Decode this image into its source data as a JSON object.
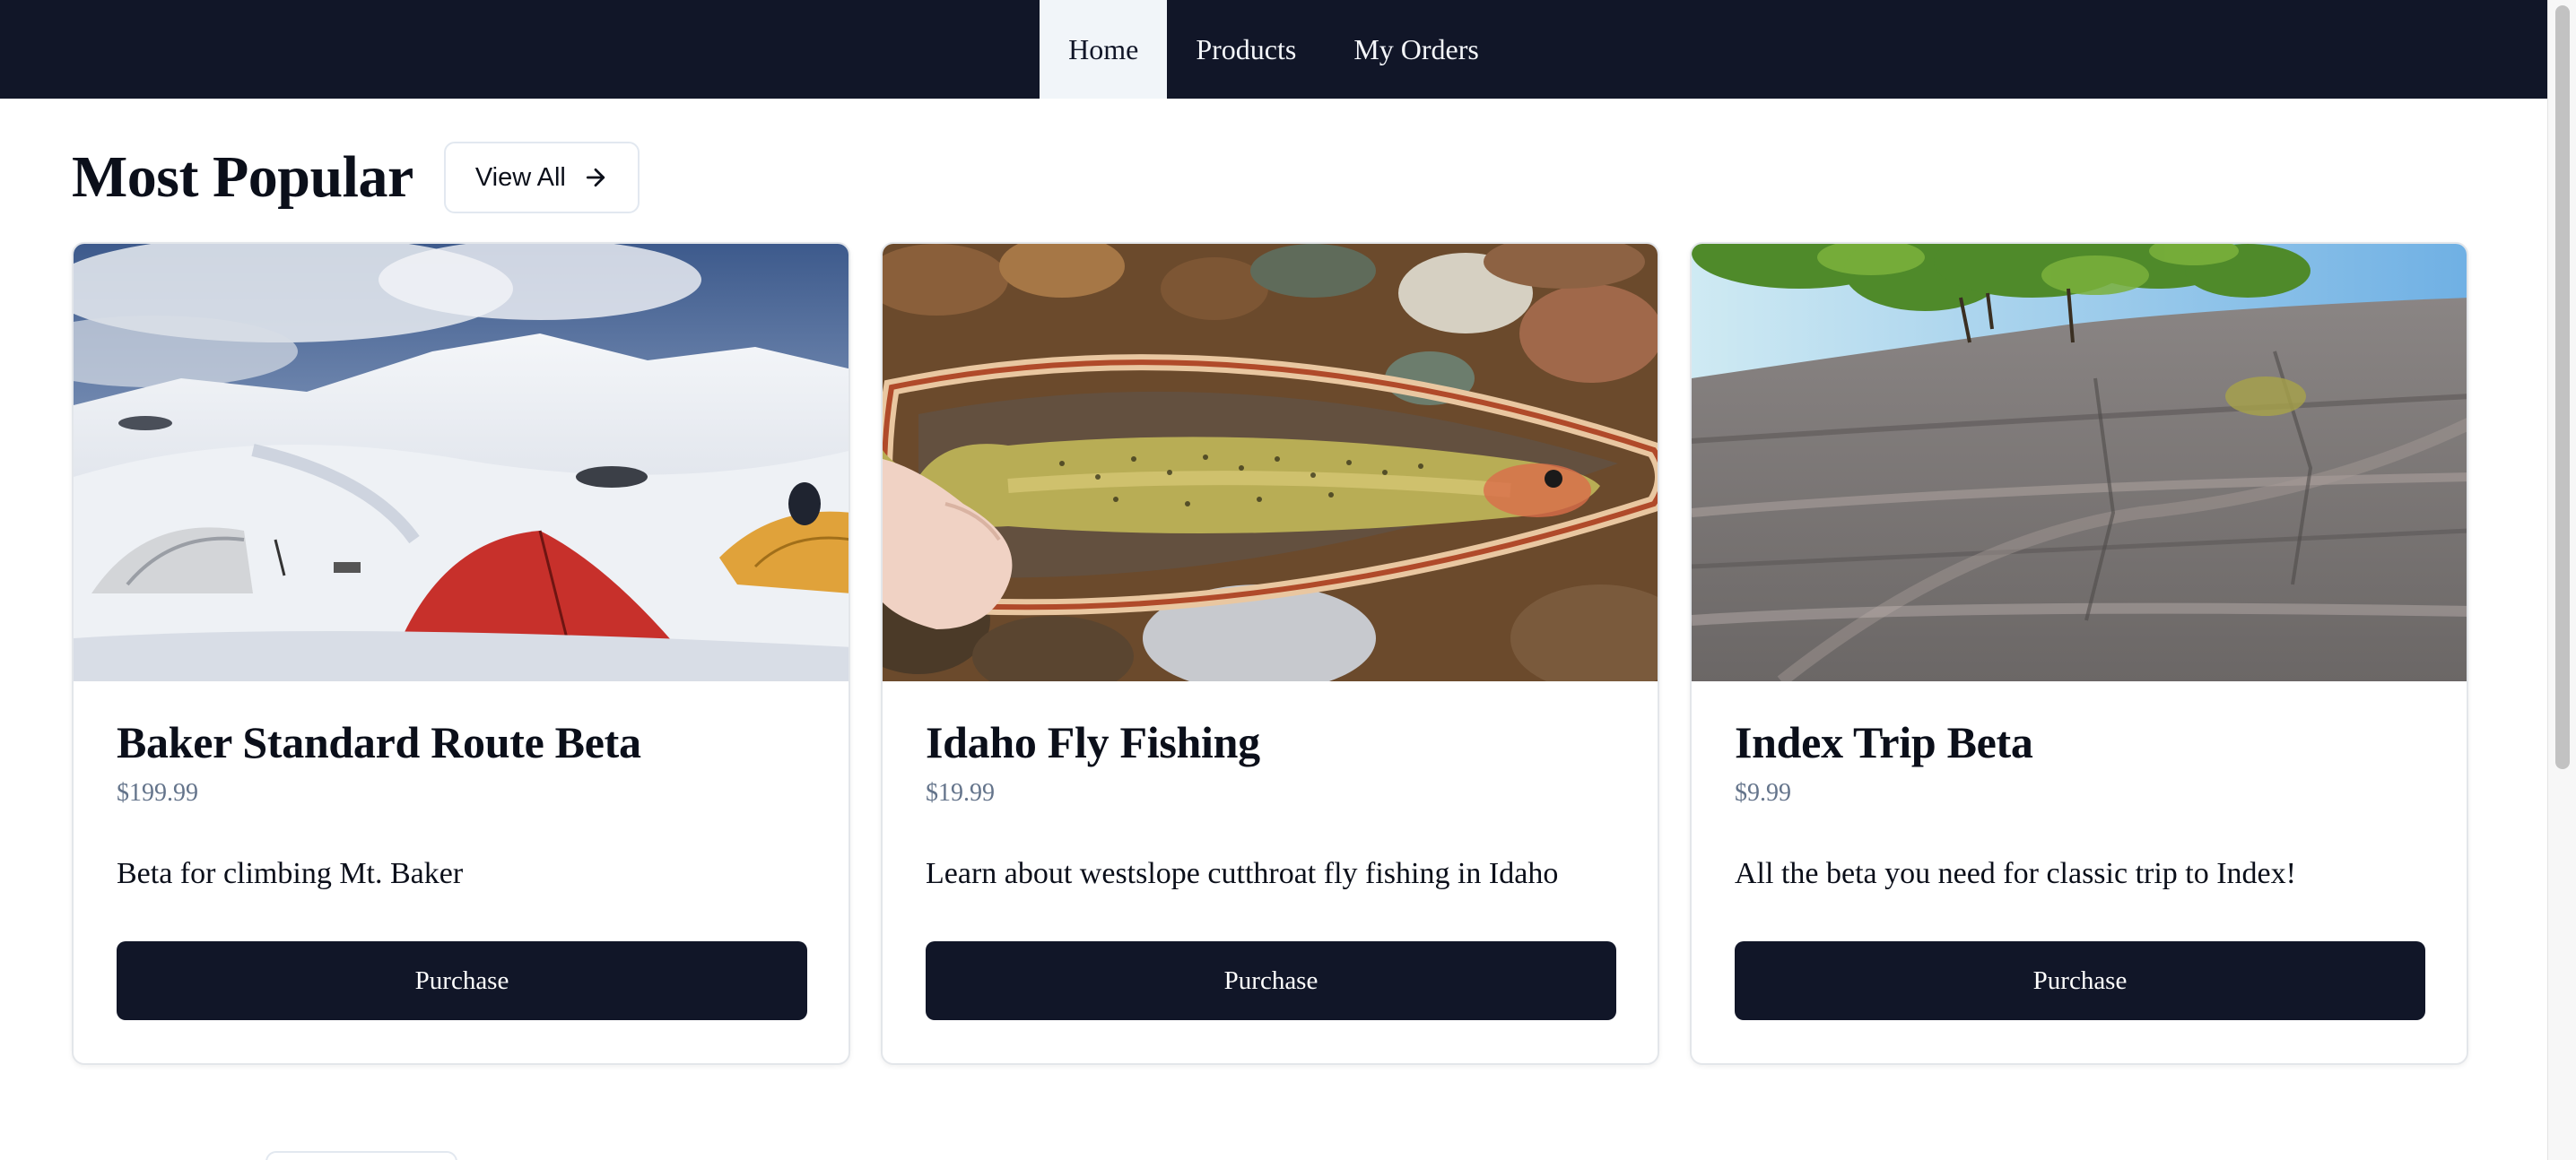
{
  "nav": {
    "items": [
      {
        "label": "Home",
        "active": true
      },
      {
        "label": "Products",
        "active": false
      },
      {
        "label": "My Orders",
        "active": false
      }
    ]
  },
  "section": {
    "title": "Most Popular",
    "view_all_label": "View All",
    "view_all_icon": "arrow-right-icon"
  },
  "products": [
    {
      "title": "Baker Standard Route Beta",
      "price": "$199.99",
      "description": "Beta for climbing Mt. Baker",
      "button": "Purchase",
      "image": "snow-camp-tents-photo"
    },
    {
      "title": "Idaho Fly Fishing",
      "price": "$19.99",
      "description": "Learn about westslope cutthroat fly fishing in Idaho",
      "button": "Purchase",
      "image": "cutthroat-trout-in-net-photo"
    },
    {
      "title": "Index Trip Beta",
      "price": "$9.99",
      "description": "All the beta you need for classic trip to Index!",
      "button": "Purchase",
      "image": "granite-rock-wall-photo"
    }
  ],
  "colors": {
    "nav_bg": "#111628",
    "nav_active_bg": "#f1f5f9",
    "button_bg": "#111628",
    "price_text": "#64748b",
    "card_border": "#e3e6ea"
  }
}
